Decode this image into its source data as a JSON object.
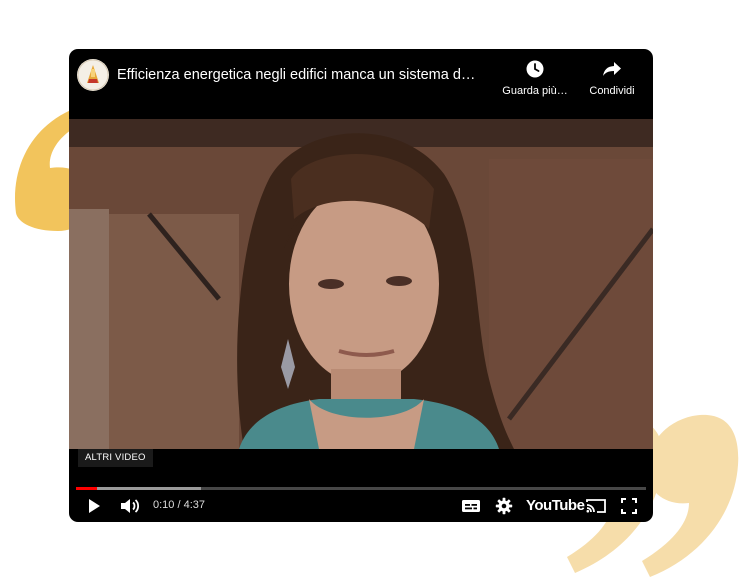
{
  "video": {
    "title": "Efficienza energetica negli edifici manca un sistema d…",
    "more_videos_label": "ALTRI VIDEO"
  },
  "top_actions": {
    "watch_later_label": "Guarda più…",
    "share_label": "Condividi"
  },
  "playback": {
    "current_time": "0:10",
    "duration": "4:37",
    "time_display": "0:10 / 4:37",
    "played_fraction": 0.036,
    "buffered_fraction": 0.22
  },
  "brand": {
    "logo_text": "YouTube"
  },
  "colors": {
    "quote_open": "#f2c45c",
    "quote_close": "#f6ddaa",
    "progress_played": "#ff0000"
  },
  "icons": {
    "watch_later": "clock-icon",
    "share": "share-arrow-icon",
    "play": "play-icon",
    "volume": "volume-icon",
    "subtitles": "subtitles-icon",
    "settings": "gear-icon",
    "cast": "cast-icon",
    "fullscreen": "fullscreen-icon"
  }
}
